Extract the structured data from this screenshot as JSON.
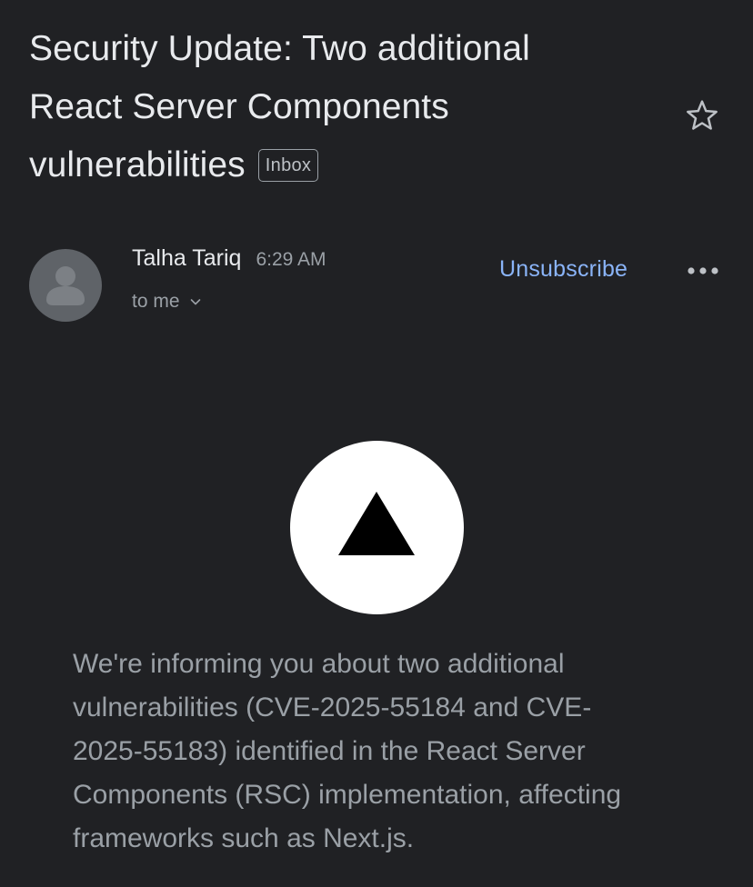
{
  "email": {
    "subject_lines": [
      "Security Update: Two additional",
      "React Server Components",
      "vulnerabilities"
    ],
    "label": "Inbox",
    "sender": "Talha Tariq",
    "time": "6:29 AM",
    "recipient": "to me",
    "unsubscribe_label": "Unsubscribe",
    "body_lines": [
      "We're informing you about two additional",
      "vulnerabilities (CVE-2025-55184 and CVE-",
      "2025-55183) identified in the React Server",
      "Components (RSC) implementation, affecting",
      "frameworks such as Next.js."
    ]
  },
  "icons": {
    "star": "star-outline-icon",
    "more": "more-horizontal-icon",
    "avatar": "default-avatar-icon",
    "logo": "vercel-triangle-logo",
    "chevron": "chevron-down-icon"
  },
  "colors": {
    "background": "#202124",
    "text_primary": "#e8eaed",
    "text_secondary": "#9aa0a6",
    "link": "#8ab4f8",
    "avatar_bg": "#5f6368"
  }
}
